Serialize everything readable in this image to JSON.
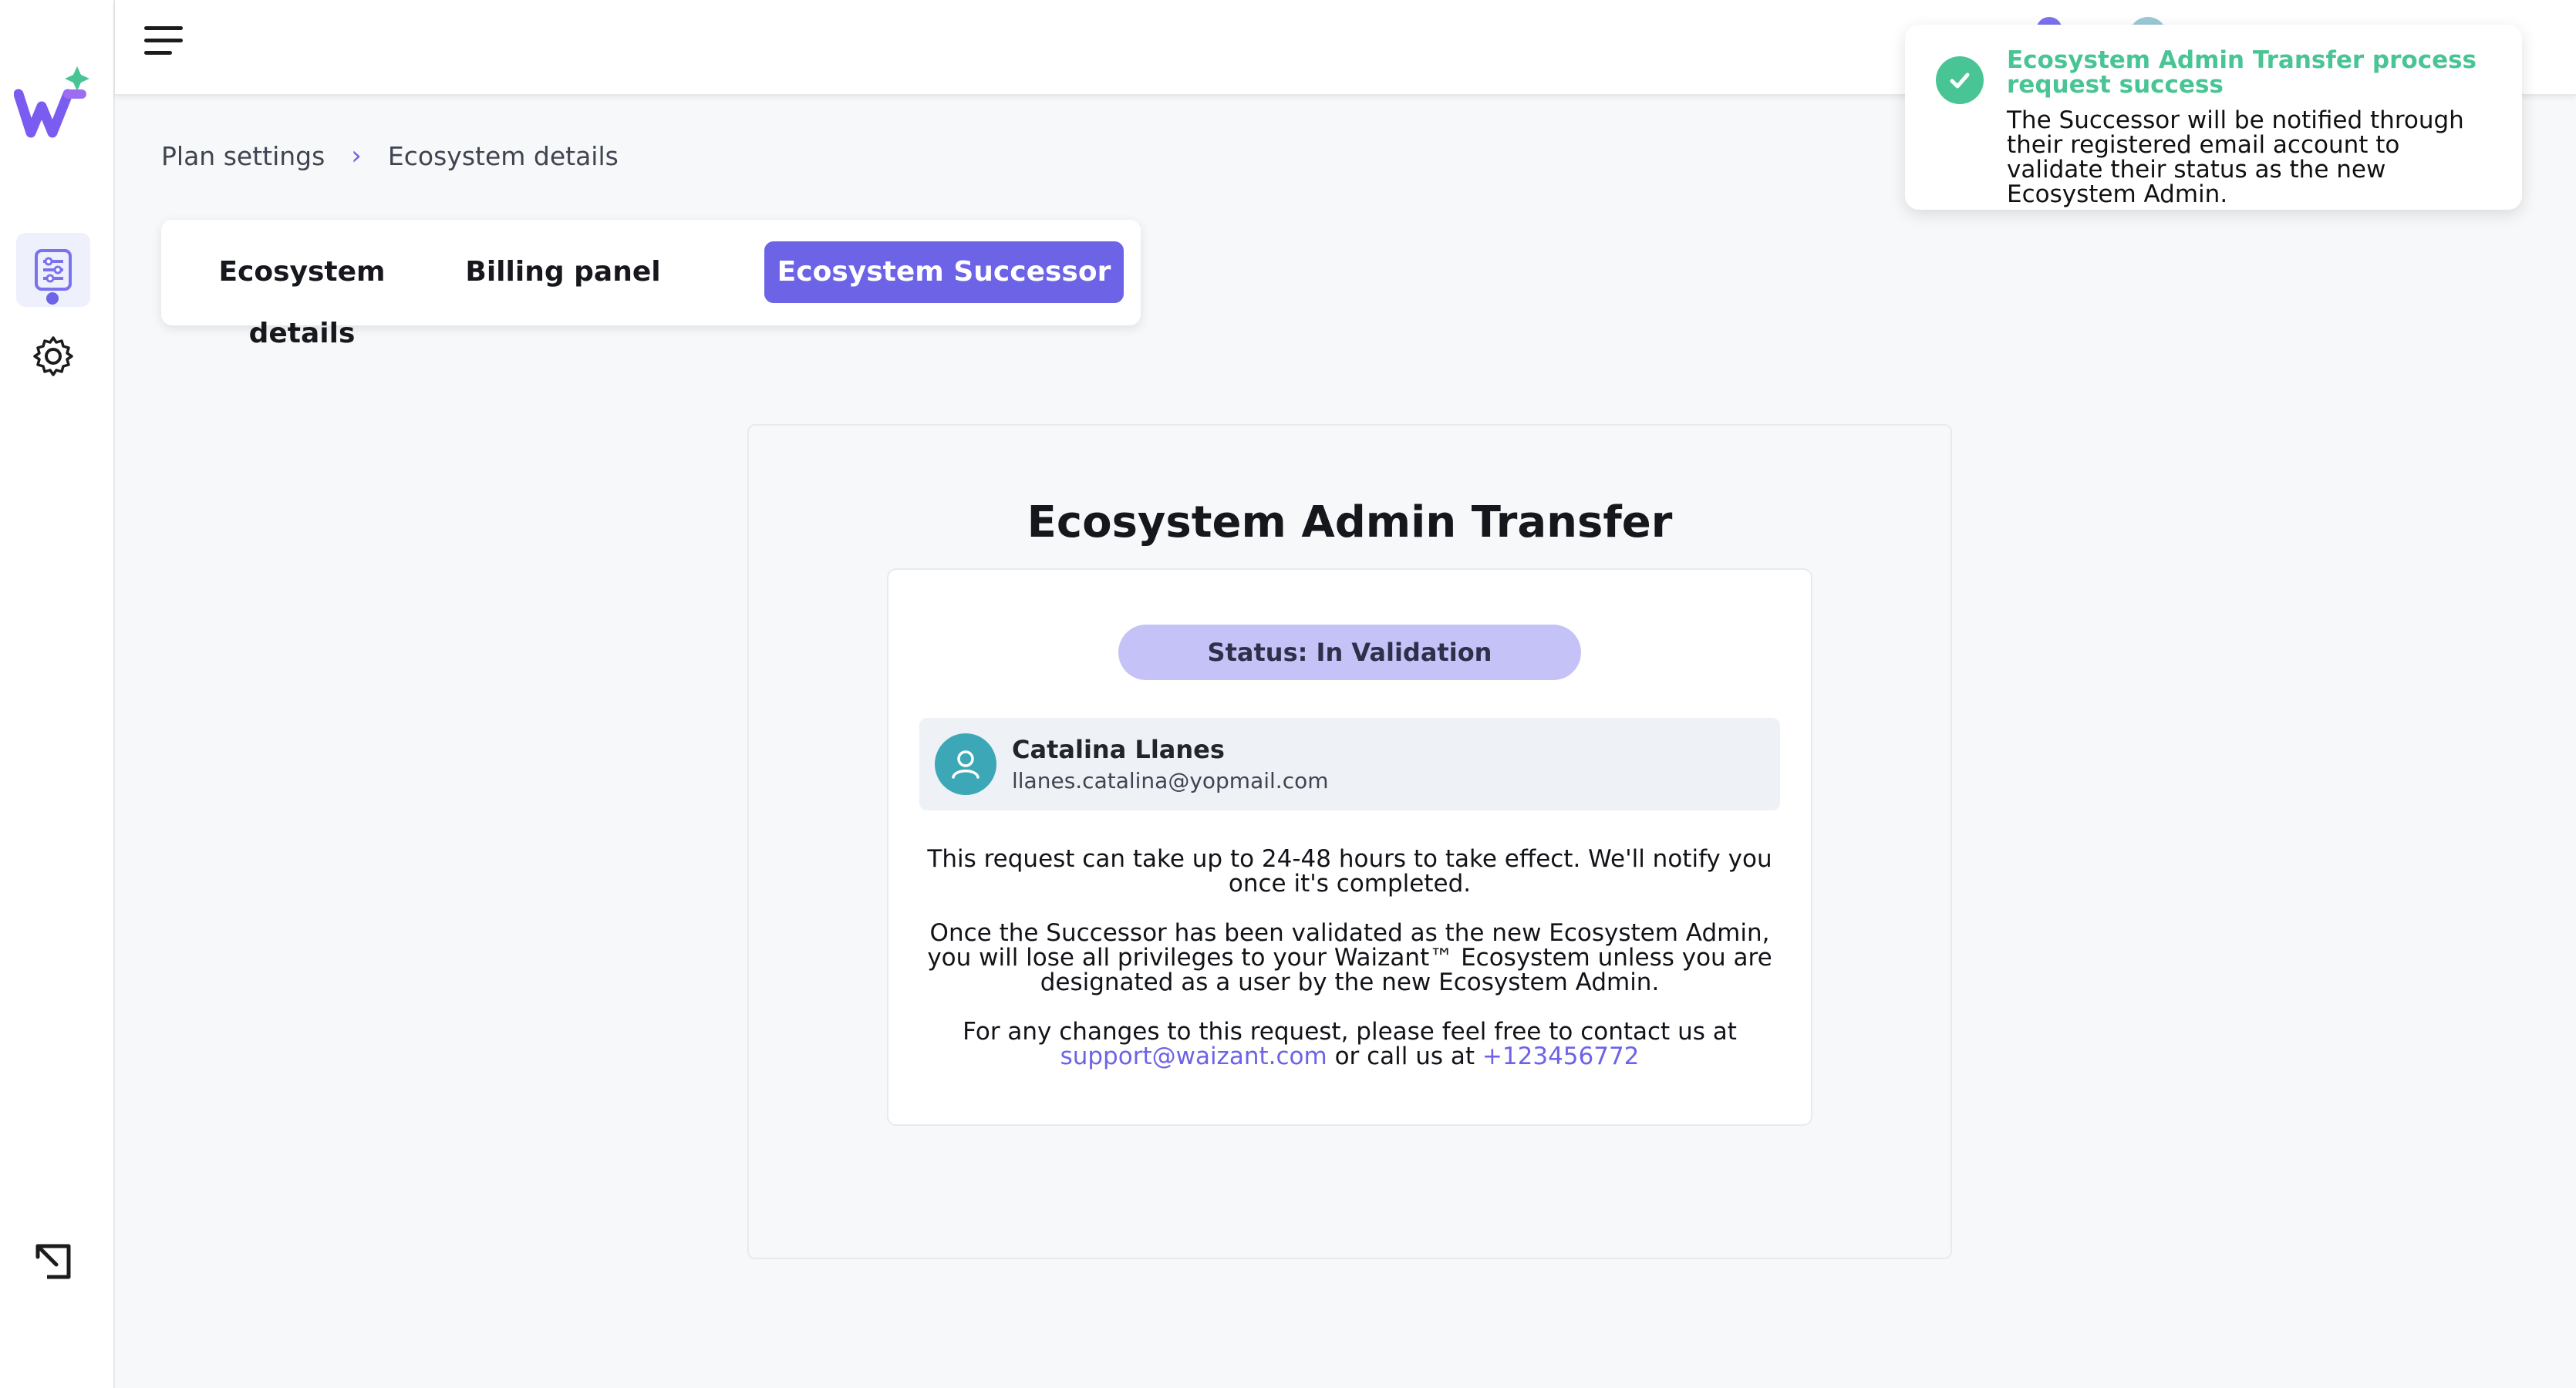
{
  "breadcrumb": {
    "root": "Plan settings",
    "current": "Ecosystem details"
  },
  "tabs": [
    {
      "label": "Ecosystem details",
      "active": false
    },
    {
      "label": "Billing panel",
      "active": false
    },
    {
      "label": "Ecosystem Successor",
      "active": true
    }
  ],
  "card": {
    "title": "Ecosystem Admin Transfer",
    "status": "Status: In Validation",
    "user": {
      "name": "Catalina Llanes",
      "email": "llanes.catalina@yopmail.com"
    },
    "para1": "This request can take up to 24-48 hours to take effect. We'll notify you once it's completed.",
    "para2": "Once the Successor has been validated as the new Ecosystem Admin, you will lose all privileges to your Waizant™ Ecosystem unless you are designated as a user by the new Ecosystem Admin.",
    "para3_prefix": "For any changes to this request, please feel free to contact us at",
    "support_email": "support@waizant.com",
    "para3_mid": "or call us at",
    "phone": "+123456772"
  },
  "toast": {
    "title": "Ecosystem Admin Transfer process request success",
    "body": "The Successor will be notified through their registered email account to validate their status as the new Ecosystem Admin."
  },
  "colors": {
    "accent": "#6c63e6",
    "success": "#49c494",
    "status_bg": "#c5c2f7"
  },
  "icons": [
    "menu-icon",
    "plan-settings-icon",
    "gear-icon",
    "exit-icon",
    "user-icon",
    "check-icon",
    "chevron-right-icon"
  ]
}
